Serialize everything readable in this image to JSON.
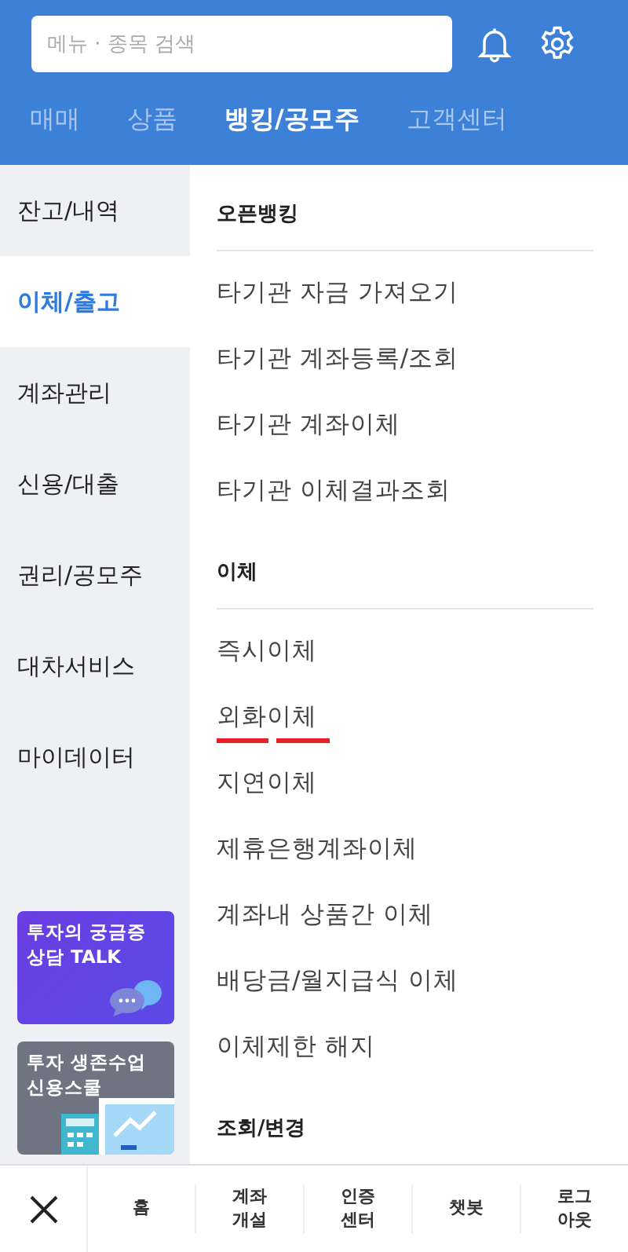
{
  "search": {
    "placeholder": "메뉴 · 종목 검색"
  },
  "tabs": [
    {
      "label": "매매",
      "selected": false
    },
    {
      "label": "상품",
      "selected": false
    },
    {
      "label": "뱅킹/공모주",
      "selected": true
    },
    {
      "label": "고객센터",
      "selected": false
    }
  ],
  "sidebar": {
    "items": [
      {
        "label": "잔고/내역",
        "selected": false
      },
      {
        "label": "이체/출고",
        "selected": true
      },
      {
        "label": "계좌관리",
        "selected": false
      },
      {
        "label": "신용/대출",
        "selected": false
      },
      {
        "label": "권리/공모주",
        "selected": false
      },
      {
        "label": "대차서비스",
        "selected": false
      },
      {
        "label": "마이데이터",
        "selected": false
      }
    ],
    "banners": [
      {
        "kind": "talk",
        "text": "투자의 궁금증\n상담 TALK"
      },
      {
        "kind": "school",
        "text": "투자 생존수업\n신용스쿨"
      }
    ]
  },
  "sections": [
    {
      "title": "오픈뱅킹",
      "items": [
        {
          "label": "타기관 자금 가져오기",
          "marked": false
        },
        {
          "label": "타기관 계좌등록/조회",
          "marked": false
        },
        {
          "label": "타기관 계좌이체",
          "marked": false
        },
        {
          "label": "타기관 이체결과조회",
          "marked": false
        }
      ]
    },
    {
      "title": "이체",
      "items": [
        {
          "label": "즉시이체",
          "marked": false
        },
        {
          "label": "외화이체",
          "marked": true
        },
        {
          "label": "지연이체",
          "marked": false
        },
        {
          "label": "제휴은행계좌이체",
          "marked": false
        },
        {
          "label": "계좌내 상품간 이체",
          "marked": false
        },
        {
          "label": "배당금/월지급식 이체",
          "marked": false
        },
        {
          "label": "이체제한 해지",
          "marked": false
        }
      ]
    },
    {
      "title": "조회/변경"
    }
  ],
  "bottom_bar": {
    "items": [
      "홈",
      "계좌\n개설",
      "인증\n센터",
      "챗봇",
      "로그\n아웃"
    ]
  }
}
